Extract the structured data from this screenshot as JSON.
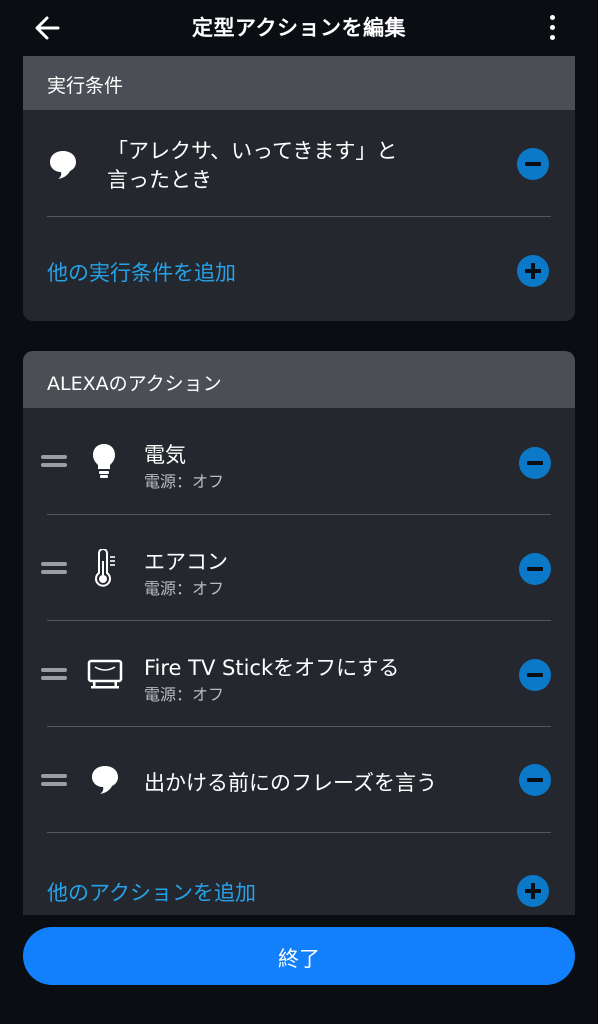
{
  "header": {
    "title": "定型アクションを編集",
    "back_icon": "arrow-left-icon",
    "menu_icon": "more-vertical-icon"
  },
  "trigger_section": {
    "heading": "実行条件",
    "trigger": {
      "icon": "speech-bubble-icon",
      "line1": "「アレクサ、いってきます」と",
      "line2": "言ったとき"
    },
    "add_label": "他の実行条件を追加"
  },
  "actions_section": {
    "heading": "ALEXAのアクション",
    "actions": [
      {
        "icon": "light-bulb-icon",
        "title": "電気",
        "subtitle": "電源：オフ"
      },
      {
        "icon": "thermometer-icon",
        "title": "エアコン",
        "subtitle": "電源：オフ"
      },
      {
        "icon": "tv-icon",
        "title": "Fire TV Stickをオフにする",
        "subtitle": "電源：オフ"
      },
      {
        "icon": "speech-bubble-icon",
        "title": "出かける前にのフレーズを言う",
        "subtitle": ""
      }
    ],
    "add_label": "他のアクションを追加"
  },
  "footer": {
    "done_label": "終了"
  },
  "colors": {
    "accent": "#0b79c7",
    "link": "#27a2e8",
    "primary_button": "#1380fb",
    "card": "#24282e",
    "section_header": "#4b4e54"
  }
}
